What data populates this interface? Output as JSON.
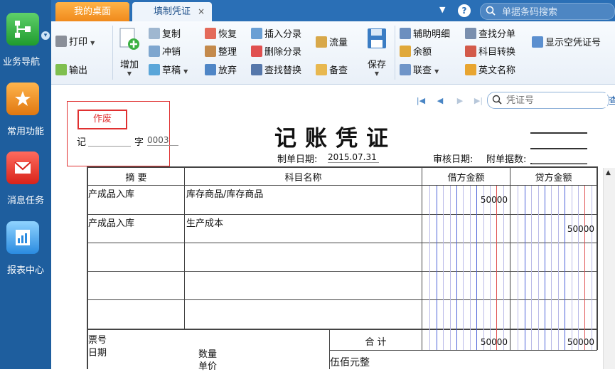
{
  "nav": {
    "items": [
      {
        "label": "业务导航",
        "icon": "business-nav-icon"
      },
      {
        "label": "常用功能",
        "icon": "star-folder-icon"
      },
      {
        "label": "消息任务",
        "icon": "mail-icon"
      },
      {
        "label": "报表中心",
        "icon": "report-icon"
      }
    ]
  },
  "tabs": {
    "desktop": "我的桌面",
    "voucher": "填制凭证",
    "close": "×"
  },
  "topbar": {
    "help": "?",
    "search_placeholder": "单据条码搜索"
  },
  "ribbon": {
    "print": "打印",
    "export": "输出",
    "add": "增加",
    "copy": "复制",
    "reverse": "冲销",
    "draft": "草稿",
    "restore": "恢复",
    "organize": "整理",
    "abandon": "放弃",
    "insert_entry": "插入分录",
    "delete_entry": "删除分录",
    "find_replace": "查找替换",
    "flow": "流量",
    "memo": "备查",
    "save": "保存",
    "aux_detail": "辅助明细",
    "balance": "余额",
    "linked_query": "联查",
    "find_entry": "查找分单",
    "subject_convert": "科目转换",
    "english_name": "英文名称",
    "show_empty_no": "显示空凭证号"
  },
  "voucher": {
    "search_placeholder": "凭证号",
    "query_link": "查",
    "void_stamp": "作废",
    "word": "记",
    "zi": "字",
    "number": "0003",
    "title": "记账凭证",
    "make_date_label": "制单日期:",
    "make_date": "2015.07.31",
    "review_date_label": "审核日期:",
    "attach_label": "附单据数:"
  },
  "table": {
    "headers": {
      "summary": "摘 要",
      "subject": "科目名称",
      "debit": "借方金额",
      "credit": "贷方金额"
    },
    "rows": [
      {
        "summary": "产成品入库",
        "subject": "库存商品/库存商品",
        "debit": "50000",
        "credit": ""
      },
      {
        "summary": "产成品入库",
        "subject": "生产成本",
        "debit": "",
        "credit": "50000"
      },
      {
        "summary": "",
        "subject": "",
        "debit": "",
        "credit": ""
      },
      {
        "summary": "",
        "subject": "",
        "debit": "",
        "credit": ""
      },
      {
        "summary": "",
        "subject": "",
        "debit": "",
        "credit": ""
      }
    ],
    "footer": {
      "ticket_label": "票号",
      "date_label": "日期",
      "qty_label": "数量",
      "price_label": "单价",
      "total_label": "合 计",
      "total_debit": "50000",
      "total_credit": "50000",
      "amount_in_words": "伍佰元整"
    }
  }
}
